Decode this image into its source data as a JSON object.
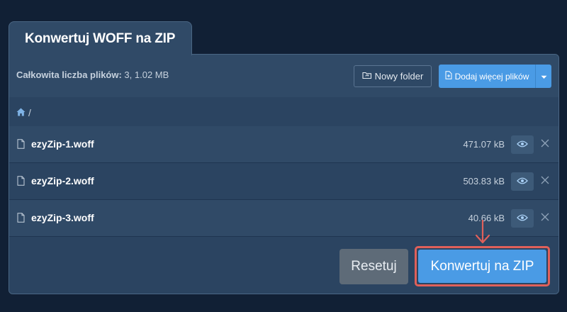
{
  "tab": {
    "title": "Konwertuj WOFF na ZIP"
  },
  "summary": {
    "label": "Całkowita liczba plików:",
    "value": " 3, 1.02 MB"
  },
  "toolbar": {
    "new_folder_label": "Nowy folder",
    "add_files_label": "Dodaj więcej plików"
  },
  "breadcrumb": {
    "path": "/"
  },
  "files": [
    {
      "name": "ezyZip-1.woff",
      "size": "471.07 kB"
    },
    {
      "name": "ezyZip-2.woff",
      "size": "503.83 kB"
    },
    {
      "name": "ezyZip-3.woff",
      "size": "40.66 kB"
    }
  ],
  "actions": {
    "reset_label": "Resetuj",
    "convert_label": "Konwertuj na ZIP"
  },
  "colors": {
    "background": "#112035",
    "panel": "#2b4461",
    "accent": "#4a9be5",
    "highlight": "#e0605a",
    "reset": "#5e6b78"
  }
}
